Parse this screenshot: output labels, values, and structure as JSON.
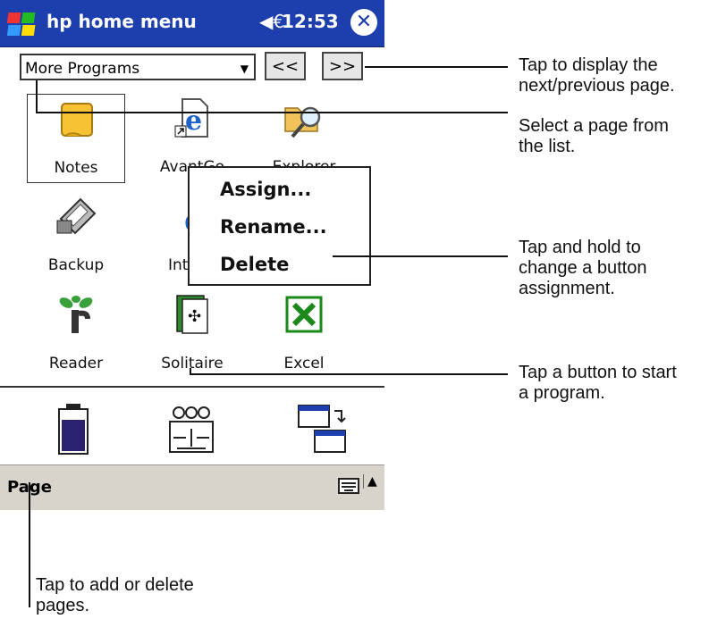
{
  "titlebar": {
    "title": "hp home menu",
    "speaker": "◀€",
    "clock": "12:53",
    "close": "✕"
  },
  "pagebar": {
    "selected_page": "More Programs",
    "prev": "<<",
    "next": ">>"
  },
  "apps": [
    {
      "label": "Notes"
    },
    {
      "label": "AvantGo"
    },
    {
      "label": "Explorer"
    },
    {
      "label": "Backup"
    },
    {
      "label": "Int"
    },
    {
      "label": "Reader"
    },
    {
      "label": "Solitaire"
    },
    {
      "label": "Excel"
    }
  ],
  "context_menu": {
    "items": [
      "Assign...",
      "Rename...",
      "Delete"
    ]
  },
  "command_bar": {
    "menu": "Page"
  },
  "callouts": [
    "Tap to display the next/previous page.",
    "Select a page from the list.",
    "Tap and hold to change a button assignment.",
    "Tap a button to start a program.",
    "Tap to add or delete pages."
  ],
  "callout_lines": [
    [
      "Tap to display the",
      "next/previous page."
    ],
    [
      "Select a page from",
      "the list."
    ],
    [
      "Tap and hold to",
      "change a button",
      "assignment."
    ],
    [
      "Tap a button to start",
      "a program."
    ],
    [
      "Tap to add or delete",
      "pages."
    ]
  ],
  "colors": {
    "titlebar": "#1d3fae",
    "command_bar": "#d8d4cc"
  }
}
